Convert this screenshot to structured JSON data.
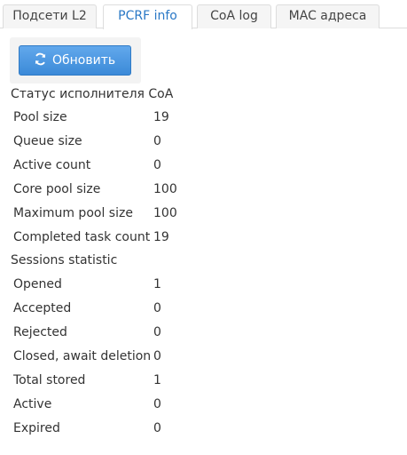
{
  "tabs": [
    {
      "label": "Подсети L2",
      "active": false
    },
    {
      "label": "PCRF info",
      "active": true
    },
    {
      "label": "CoA log",
      "active": false
    },
    {
      "label": "MAC адреса",
      "active": false
    }
  ],
  "toolbar": {
    "refresh_label": "Обновить",
    "refresh_icon": "refresh-icon"
  },
  "coa_executor": {
    "title": "Статус исполнителя CoA",
    "rows": [
      {
        "label": "Pool size",
        "value": "19"
      },
      {
        "label": "Queue size",
        "value": "0"
      },
      {
        "label": "Active count",
        "value": "0"
      },
      {
        "label": "Core pool size",
        "value": "100"
      },
      {
        "label": "Maximum pool size",
        "value": "100"
      },
      {
        "label": "Completed task count",
        "value": "19"
      }
    ]
  },
  "sessions": {
    "title": "Sessions statistic",
    "rows": [
      {
        "label": "Opened",
        "value": "1"
      },
      {
        "label": "Accepted",
        "value": "0"
      },
      {
        "label": "Rejected",
        "value": "0"
      },
      {
        "label": "Closed, await deletion",
        "value": "0"
      },
      {
        "label": "Total stored",
        "value": "1"
      },
      {
        "label": "Active",
        "value": "0"
      },
      {
        "label": "Expired",
        "value": "0"
      }
    ]
  }
}
